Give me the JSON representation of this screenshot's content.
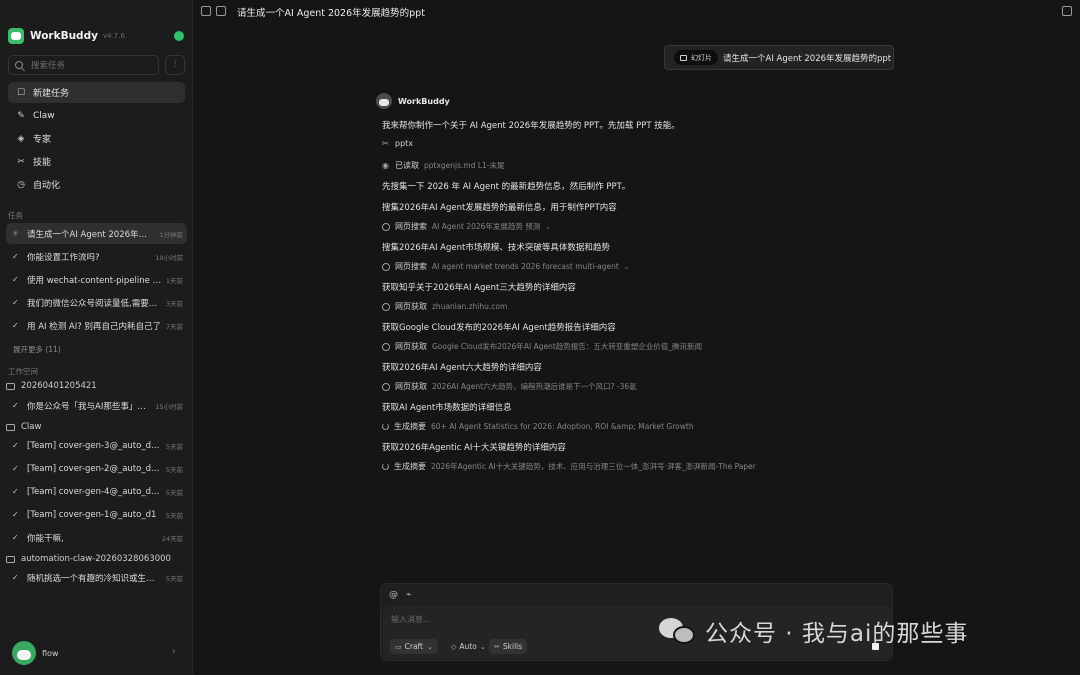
{
  "sidebar": {
    "brand": "WorkBuddy",
    "version": "v4.7.6",
    "search_placeholder": "搜索任务",
    "filter_icon": "sliders-icon",
    "nav": [
      {
        "label": "新建任务",
        "icon": "new-task-icon"
      },
      {
        "label": "Claw",
        "icon": "claw-icon"
      },
      {
        "label": "专家",
        "icon": "expert-icon"
      },
      {
        "label": "技能",
        "icon": "skills-icon"
      },
      {
        "label": "自动化",
        "icon": "clock-icon"
      }
    ],
    "tasks_label": "任务",
    "tasks": [
      {
        "title": "请生成一个AI Agent 2026年发展趋势的ppt",
        "time": "1分钟前"
      },
      {
        "title": "你能设置工作流吗?",
        "time": "19小时前"
      },
      {
        "title": "使用 wechat-content-pipeline 技能",
        "time": "1天前"
      },
      {
        "title": "我们的微信公众号阅读量低,需要分析",
        "time": "3天前"
      },
      {
        "title": "用 AI 检测 AI? 别再自己内耗自己了",
        "time": "7天前"
      }
    ],
    "expand_more": "展开更多 (11)",
    "workspace_label": "工作空间",
    "workspaces": [
      {
        "folder": "20260401205421",
        "items": [
          {
            "title": "你是公众号「我与AI那些事」的运营助手",
            "time": "15小时前"
          }
        ]
      },
      {
        "folder": "Claw",
        "items": [
          {
            "title": "[Team] cover-gen-3@_auto_default",
            "time": "5天前"
          },
          {
            "title": "[Team] cover-gen-2@_auto_default",
            "time": "5天前"
          },
          {
            "title": "[Team] cover-gen-4@_auto_default",
            "time": "5天前"
          },
          {
            "title": "[Team] cover-gen-1@_auto_d1",
            "time": "5天前"
          },
          {
            "title": "你能干嘛,",
            "time": "24天前"
          }
        ]
      },
      {
        "folder": "automation-claw-20260328063000",
        "items": [
          {
            "title": "随机挑选一个有趣的冷知识或生活小技巧",
            "time": "5天前"
          }
        ]
      }
    ],
    "user_name": "flow"
  },
  "main": {
    "title": "请生成一个AI Agent 2026年发展趋势的ppt",
    "user_message": {
      "chip": "幻灯片",
      "text": "请生成一个AI Agent 2026年发展趋势的ppt"
    },
    "assistant_name": "WorkBuddy",
    "lines": [
      {
        "kind": "text",
        "text": "我来帮你制作一个关于 AI Agent 2026年发展趋势的 PPT。先加载 PPT 技能。"
      },
      {
        "kind": "skill",
        "label": "pptx",
        "detail": ""
      },
      {
        "kind": "read",
        "label": "已读取",
        "detail": "pptxgenjs.md  L1-末尾"
      },
      {
        "kind": "text",
        "text": "先搜集一下 2026 年 AI Agent 的最新趋势信息，然后制作 PPT。"
      },
      {
        "kind": "text",
        "text": "搜集2026年AI Agent发展趋势的最新信息，用于制作PPT内容"
      },
      {
        "kind": "web",
        "label": "网页搜索",
        "detail": "AI Agent 2026年发展趋势 预测",
        "caret": true
      },
      {
        "kind": "text",
        "text": "搜集2026年AI Agent市场规模、技术突破等具体数据和趋势"
      },
      {
        "kind": "web",
        "label": "网页搜索",
        "detail": "AI agent market trends 2026 forecast multi-agent",
        "caret": true
      },
      {
        "kind": "text",
        "text": "获取知乎关于2026年AI Agent三大趋势的详细内容"
      },
      {
        "kind": "web",
        "label": "网页获取",
        "detail": "zhuanlan.zhihu.com"
      },
      {
        "kind": "text",
        "text": "获取Google Cloud发布的2026年AI Agent趋势报告详细内容"
      },
      {
        "kind": "web",
        "label": "网页获取",
        "detail": "Google Cloud发布2026年AI Agent趋势报告：五大转变重塑企业价值_腾讯新闻"
      },
      {
        "kind": "text",
        "text": "获取2026年AI Agent六大趋势的详细内容"
      },
      {
        "kind": "web",
        "label": "网页获取",
        "detail": "2026AI Agent六大趋势，编程热潮后谁是下一个风口? -36氪"
      },
      {
        "kind": "text",
        "text": "获取AI Agent市场数据的详细信息"
      },
      {
        "kind": "spin",
        "label": "生成摘要",
        "detail": "60+ AI Agent Statistics for 2026: Adoption, ROI &amp; Market Growth"
      },
      {
        "kind": "text",
        "text": "获取2026年Agentic AI十大关键趋势的详细内容"
      },
      {
        "kind": "spin",
        "label": "生成摘要",
        "detail": "2026年Agentic AI十大关键趋势，技术、应用与治理三位一体_澎湃号·湃客_澎湃新闻-The Paper"
      }
    ],
    "composer": {
      "placeholder": "输入消息...",
      "craft": "Craft",
      "auto": "Auto",
      "skills": "Skills"
    }
  },
  "watermark": "公众号 · 我与ai的那些事",
  "colors": {
    "accent_green": "#2fc26b",
    "background": "#151515",
    "sidebar": "#1c1c1c"
  }
}
